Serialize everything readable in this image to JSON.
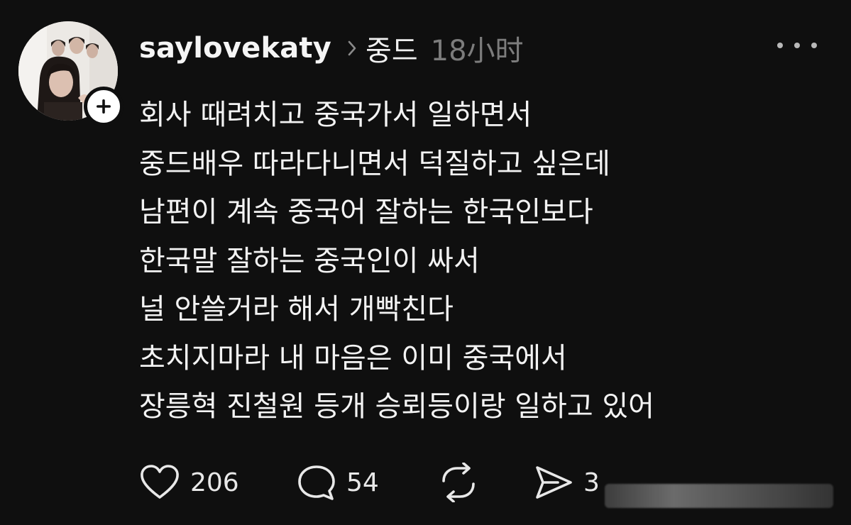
{
  "post": {
    "username": "saylovekaty",
    "topic": "중드",
    "time": "18小时",
    "lines": [
      "회사 때려치고 중국가서 일하면서",
      "중드배우 따라다니면서 덕질하고 싶은데",
      "남편이 계속 중국어 잘하는 한국인보다",
      "한국말 잘하는 중국인이 싸서",
      "널 안쓸거라 해서 개빡친다",
      "초치지마라 내 마음은 이미 중국에서",
      "장릉혁 진철원 등개 승뢰등이랑 일하고 있어"
    ]
  },
  "actions": {
    "likes": "206",
    "comments": "54",
    "shares": "3"
  },
  "icons": {
    "follow": "plus-icon",
    "topic_separator": "chevron-right-icon",
    "more": "more-horizontal-icon",
    "like": "heart-icon",
    "comment": "speech-bubble-icon",
    "repost": "repost-icon",
    "share": "send-icon"
  },
  "colors": {
    "background": "#0f0f0f",
    "text": "#f3f3f3",
    "muted": "#7c7c7c"
  }
}
